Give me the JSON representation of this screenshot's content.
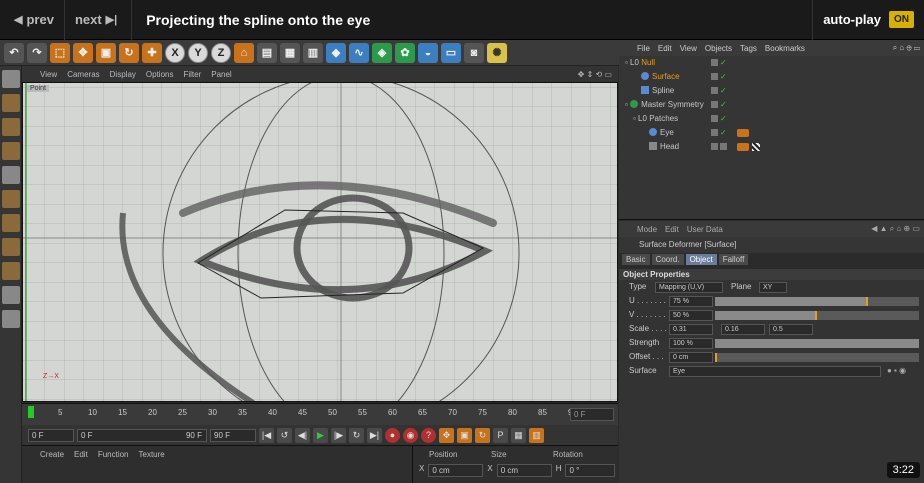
{
  "video": {
    "prev_label": "prev",
    "next_label": "next",
    "title": "Projecting the spline onto the eye",
    "autoplay_label": "auto-play",
    "autoplay_state": "ON",
    "timestamp": "3:22"
  },
  "viewport": {
    "menu": [
      "View",
      "Cameras",
      "Display",
      "Options",
      "Filter",
      "Panel"
    ],
    "label": "Point",
    "axes_label": "Z→X"
  },
  "timeline": {
    "ticks": [
      "0",
      "5",
      "10",
      "15",
      "20",
      "25",
      "30",
      "35",
      "40",
      "45",
      "50",
      "55",
      "60",
      "65",
      "70",
      "75",
      "80",
      "85",
      "90"
    ],
    "current": "0 F"
  },
  "transport": {
    "start": "0 F",
    "range_start": "0 F",
    "range_end": "90 F",
    "end": "90 F"
  },
  "material": {
    "menu": [
      "Create",
      "Edit",
      "Function",
      "Texture"
    ]
  },
  "coords": {
    "headers": [
      "Position",
      "Size",
      "Rotation"
    ],
    "x_pos": "0 cm",
    "x_size": "0 cm",
    "h_rot": "0 °",
    "axis_x": "X",
    "axis_h": "H"
  },
  "objects": {
    "menu": [
      "File",
      "Edit",
      "View",
      "Objects",
      "Tags",
      "Bookmarks"
    ],
    "rows": [
      {
        "name": "Null",
        "color": "#e0a020"
      },
      {
        "name": "Surface",
        "color": "#e0a020"
      },
      {
        "name": "Spline",
        "color": "#ccc"
      },
      {
        "name": "Master Symmetry",
        "color": "#ccc"
      },
      {
        "name": "Patches",
        "color": "#ccc"
      },
      {
        "name": "Eye",
        "color": "#ccc"
      },
      {
        "name": "Head",
        "color": "#ccc"
      }
    ]
  },
  "attributes": {
    "menu": [
      "Mode",
      "Edit",
      "User Data"
    ],
    "title": "Surface Deformer [Surface]",
    "tabs": [
      "Basic",
      "Coord.",
      "Object",
      "Falloff"
    ],
    "section": "Object Properties",
    "type_label": "Type",
    "type_value": "Mapping (U,V)",
    "plane_label": "Plane",
    "plane_value": "XY",
    "u_label": "U . . . . . . .",
    "u_value": "75 %",
    "u_fraction": 0.75,
    "v_label": "V . . . . . . .",
    "v_value": "50 %",
    "v_fraction": 0.5,
    "scale_label": "Scale . . . .",
    "scale_x": "0.31",
    "scale_y": "0.16",
    "scale_z": "0.5",
    "strength_label": "Strength",
    "strength_value": "100 %",
    "strength_fraction": 1.0,
    "offset_label": "Offset . . .",
    "offset_value": "0 cm",
    "surface_label": "Surface",
    "surface_value": "Eye"
  },
  "colors": {
    "accent": "#d8b000",
    "orange": "#c8721b",
    "selection": "#6a7c9a"
  }
}
